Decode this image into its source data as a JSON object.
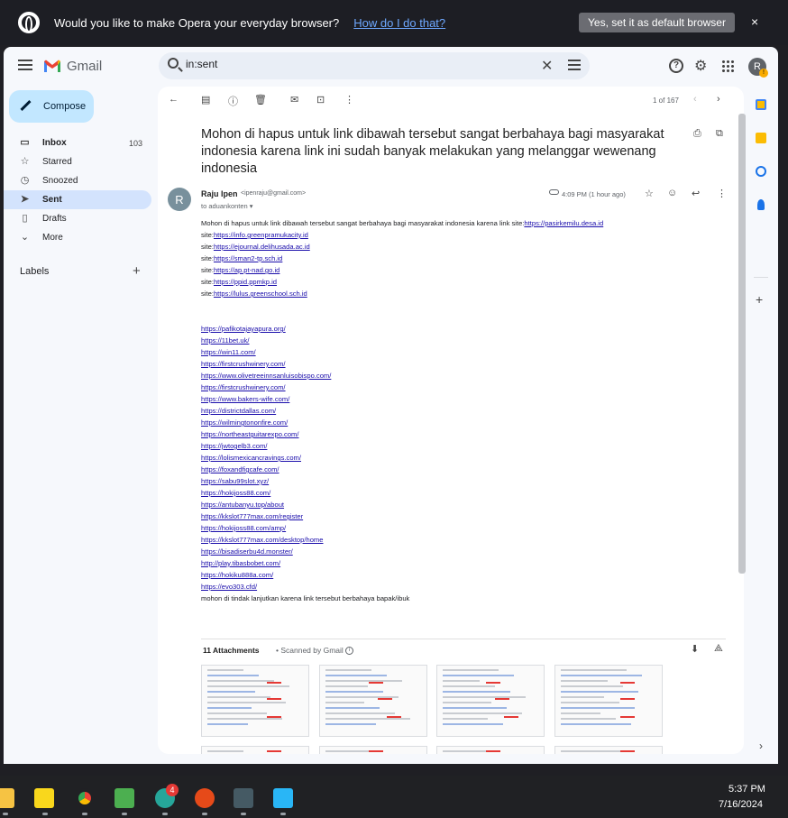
{
  "opera_bar": {
    "message": "Would you like to make Opera your everyday browser?",
    "link": "How do I do that?",
    "default_button": "Yes, set it as default browser",
    "close": "×"
  },
  "header": {
    "app_name": "Gmail",
    "search_value": "in:sent",
    "account_initial": "R",
    "account_badge": "!"
  },
  "nav": {
    "compose": "Compose",
    "items": [
      {
        "label": "Inbox",
        "count": "103",
        "icon": "inbox-icon"
      },
      {
        "label": "Starred",
        "count": "",
        "icon": "star-icon"
      },
      {
        "label": "Snoozed",
        "count": "",
        "icon": "clock-icon"
      },
      {
        "label": "Sent",
        "count": "",
        "icon": "send-icon"
      },
      {
        "label": "Drafts",
        "count": "",
        "icon": "draft-icon"
      },
      {
        "label": "More",
        "count": "",
        "icon": "chevron-down-icon"
      }
    ],
    "labels_title": "Labels",
    "labels_add": "+"
  },
  "toolbar": {
    "page_count": "1 of 167"
  },
  "email": {
    "subject": "Mohon di hapus untuk link dibawah tersebut sangat berbahaya bagi masyarakat indonesia karena link ini sudah banyak melakukan yang melanggar wewenang indonesia",
    "sender_initial": "R",
    "sender_name": "Raju Ipen",
    "sender_email": "<ipenraju@gmail.com>",
    "recipient": "to aduankonten",
    "time": "4:09 PM (1 hour ago)",
    "intro_text": "Mohon di hapus untuk link dibawah tersebut sangat berbahaya bagi masyarakat indonesia karena link site:",
    "intro_link": "https://pasirkemilu.desa.id",
    "site_prefix": "site:",
    "site_links": [
      "https://info.greenpramukacity.id",
      "https://ejournal.delihusada.ac.id",
      "https://sman2-tp.sch.id",
      "https://ap.pt-nad.go.id",
      "https://ppid.ppmkp.id",
      "https://lulus.greenschool.sch.id"
    ],
    "links": [
      "https://pafikotajayapura.org/",
      "https://11bet.uk/",
      "https://win11.com/",
      "https://firstcrushwinery.com/",
      "https://www.olivetreeinnsanluisobispo.com/",
      "https://firstcrushwinery.com/",
      "https://www.bakers-wife.com/",
      "https://districtdallas.com/",
      "https://wilmingtononfire.com/",
      "https://northeastguitarexpo.com/",
      "https://jwtogelb3.com/",
      "https://lolismexicancravings.com/",
      "https://foxandfigcafe.com/",
      "https://sabu99slot.xyz/",
      "https://hokijoss88.com/",
      "https://antubanyu.top/about",
      "https://kkslot777max.com/register",
      "https://hokijoss88.com/amp/",
      "https://kkslot777max.com/desktop/home",
      "https://bisadiserbu4d.monster/",
      "http://play.tibasbobet.com/",
      "https://hokiku888a.com/",
      "https://evo303.cfd/"
    ],
    "closing": "mohon di tindak lanjutkan karena link tersebut berbahaya bapak/ibuk"
  },
  "attachments": {
    "title": "11 Attachments",
    "scanned": "Scanned by Gmail"
  },
  "taskbar": {
    "badge": "4",
    "time": "5:37 PM",
    "date": "7/16/2024"
  },
  "colors": {
    "compose_bg": "#c2e7ff",
    "active_nav": "#d3e3fd",
    "link": "#1a0dab"
  }
}
